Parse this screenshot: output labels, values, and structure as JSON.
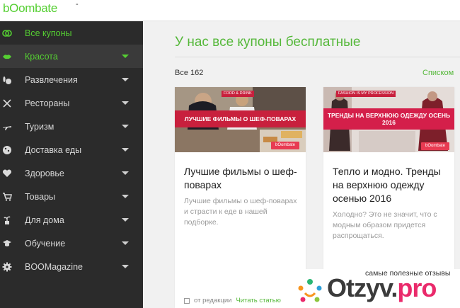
{
  "header": {
    "logo_text": "bOombate",
    "dash": "-"
  },
  "sidebar": {
    "items": [
      {
        "label": "Все купоны",
        "icon": "link-icon",
        "color": "#55cf32"
      },
      {
        "label": "Красота",
        "icon": "lips-icon",
        "color": "#55cf32"
      },
      {
        "label": "Развлечения",
        "icon": "bowling-icon",
        "color": "#d7d7d7"
      },
      {
        "label": "Рестораны",
        "icon": "cutlery-icon",
        "color": "#d7d7d7"
      },
      {
        "label": "Туризм",
        "icon": "plane-icon",
        "color": "#d7d7d7"
      },
      {
        "label": "Доставка еды",
        "icon": "pizza-icon",
        "color": "#d7d7d7"
      },
      {
        "label": "Здоровье",
        "icon": "heart-icon",
        "color": "#d7d7d7"
      },
      {
        "label": "Товары",
        "icon": "cart-icon",
        "color": "#d7d7d7"
      },
      {
        "label": "Для дома",
        "icon": "plant-icon",
        "color": "#d7d7d7"
      },
      {
        "label": "Обучение",
        "icon": "graduation-cap-icon",
        "color": "#d7d7d7"
      },
      {
        "label": "BOOMagazine",
        "icon": "gear-icon",
        "color": "#d7d7d7"
      }
    ]
  },
  "main": {
    "headline": "У нас все купоны бесплатные",
    "count": "Все 162",
    "view_toggle": "Списком",
    "cards": [
      {
        "tag": "FOOD & DRINK",
        "banner": "ЛУЧШИЕ ФИЛЬМЫ О ШЕФ-ПОВАРАХ",
        "badge": "bOombate",
        "title": "Лучшие фильмы о шеф-поварах",
        "desc": "Лучшие фильмы о шеф-поварах и страсти к еде в нашей подборке.",
        "footer_source": "от редакции",
        "footer_link": "Читать статью"
      },
      {
        "tag": "FASHION IS MY PROFESSION",
        "banner": "ТРЕНДЫ НА ВЕРХНЮЮ ОДЕЖДУ ОСЕНЬ 2016",
        "badge": "bOombate",
        "title": "Тепло и модно. Тренды на верхнюю одежду осенью 2016",
        "desc": "Холодно? Это не значит, что с модным образом придется распрощаться."
      }
    ]
  },
  "watermark": {
    "caption": "самые полезные отзывы",
    "name": "Otzyv",
    "dot": ".",
    "tld": "pro"
  },
  "colors": {
    "accent": "#55cf32",
    "sidebar_bg": "#2b2b2b",
    "banner": "#c8203d",
    "watermark_pink": "#ea2a6b"
  }
}
